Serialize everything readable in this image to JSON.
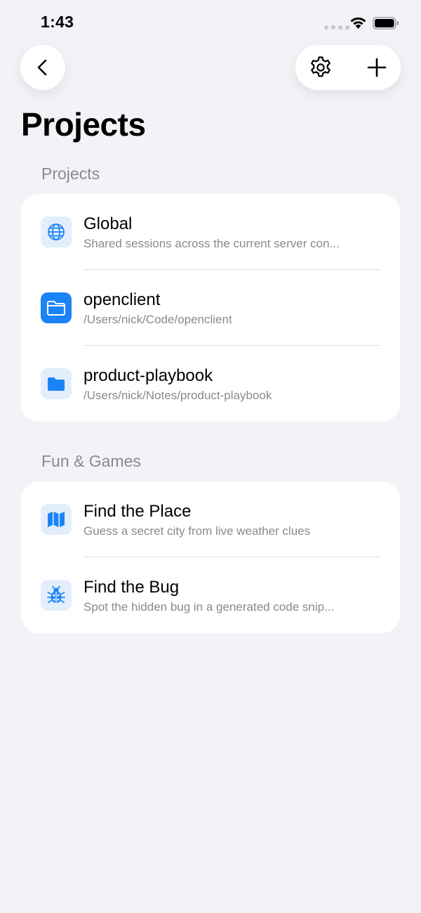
{
  "status_bar": {
    "time": "1:43"
  },
  "nav": {
    "back_icon": "chevron-left-icon",
    "settings_icon": "gear-icon",
    "add_icon": "plus-icon"
  },
  "page": {
    "title": "Projects"
  },
  "colors": {
    "accent": "#1a84f7",
    "icon_bg": "#e3eefc",
    "background": "#f2f2f7",
    "secondary_text": "#8a8a8e"
  },
  "sections": [
    {
      "header": "Projects",
      "items": [
        {
          "title": "Global",
          "subtitle": "Shared sessions across the current server con...",
          "icon": "globe-icon"
        },
        {
          "title": "openclient",
          "subtitle": "/Users/nick/Code/openclient",
          "icon": "folder-icon"
        },
        {
          "title": "product-playbook",
          "subtitle": "/Users/nick/Notes/product-playbook",
          "icon": "folder-icon"
        }
      ]
    },
    {
      "header": "Fun & Games",
      "items": [
        {
          "title": "Find the Place",
          "subtitle": "Guess a secret city from live weather clues",
          "icon": "map-icon"
        },
        {
          "title": "Find the Bug",
          "subtitle": "Spot the hidden bug in a generated code snip...",
          "icon": "ladybug-icon"
        }
      ]
    }
  ]
}
